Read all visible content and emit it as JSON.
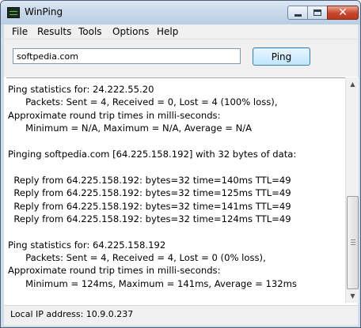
{
  "window": {
    "title": "WinPing",
    "controls": {
      "minimize": "—",
      "maximize": "□",
      "close": "✕"
    }
  },
  "menu": {
    "items": [
      "File",
      "Results",
      "Tools",
      "Options",
      "Help"
    ]
  },
  "toolbar": {
    "host_value": "softpedia.com",
    "ping_label": "Ping"
  },
  "output": {
    "lines": [
      "Ping statistics for: 24.222.55.20",
      "      Packets: Sent = 4, Received = 0, Lost = 4 (100% loss),",
      "Approximate round trip times in milli-seconds:",
      "      Minimum = N/A, Maximum = N/A, Average = N/A",
      "",
      "Pinging softpedia.com [64.225.158.192] with 32 bytes of data:",
      "",
      "  Reply from 64.225.158.192: bytes=32 time=140ms TTL=49",
      "  Reply from 64.225.158.192: bytes=32 time=125ms TTL=49",
      "  Reply from 64.225.158.192: bytes=32 time=141ms TTL=49",
      "  Reply from 64.225.158.192: bytes=32 time=124ms TTL=49",
      "",
      "Ping statistics for: 64.225.158.192",
      "      Packets: Sent = 4, Received = 4, Lost = 0 (0% loss),",
      "Approximate round trip times in milli-seconds:",
      "      Minimum = 124ms, Maximum = 141ms, Average = 132ms"
    ]
  },
  "status": {
    "text": "Local IP address: 10.9.0.237"
  },
  "colors": {
    "title_bar": "#c9d9ea",
    "close_button": "#c8452c",
    "ping_button": "#bee6fd"
  },
  "icons": {
    "app": "console-icon",
    "scroll_up": "arrow-up-icon",
    "scroll_down": "arrow-down-icon"
  }
}
